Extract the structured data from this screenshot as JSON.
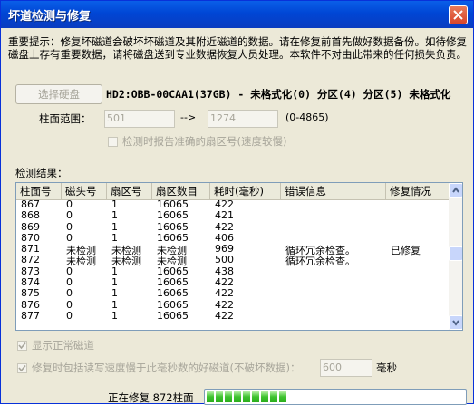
{
  "window": {
    "title": "坏道检测与修复"
  },
  "notice": "重要提示：修复坏磁道会破坏坏磁道及其附近磁道的数据。请在修复前首先做好数据备份。如待修复磁盘上存有重要数据，请将磁盘送到专业数据恢复人员处理。本软件不对由此带来的任何损失负责。",
  "disk": {
    "select_label": "选择硬盘",
    "info": "HD2:OBB-00CAA1(37GB) - 未格式化(0) 分区(4) 分区(5) 未格式化"
  },
  "cylinder": {
    "label": "柱面范围：",
    "from": "501",
    "arrow": "-->",
    "to": "1274",
    "range_hint": "(0-4865)"
  },
  "options": {
    "accurate_sector": "检测时报告准确的扇区号(速度较慢)",
    "show_normal": "显示正常磁道",
    "repair_slow": "修复时包括读写速度慢于此毫秒数的好磁道(不破坏数据)：",
    "ms_value": "600",
    "ms_unit": "毫秒"
  },
  "results": {
    "label": "检测结果：",
    "columns": [
      "柱面号",
      "磁头号",
      "扇区号",
      "扇区数目",
      "耗时(毫秒)",
      "错误信息",
      "修复情况"
    ],
    "rows": [
      [
        "867",
        "0",
        "1",
        "16065",
        "422",
        "",
        ""
      ],
      [
        "868",
        "0",
        "1",
        "16065",
        "421",
        "",
        ""
      ],
      [
        "869",
        "0",
        "1",
        "16065",
        "422",
        "",
        ""
      ],
      [
        "870",
        "0",
        "1",
        "16065",
        "406",
        "",
        ""
      ],
      [
        "871",
        "未检测",
        "未检测",
        "未检测",
        "969",
        "循环冗余检查。",
        "已修复"
      ],
      [
        "872",
        "未检测",
        "未检测",
        "未检测",
        "500",
        "循环冗余检查。",
        ""
      ],
      [
        "873",
        "0",
        "1",
        "16065",
        "438",
        "",
        ""
      ],
      [
        "874",
        "0",
        "1",
        "16065",
        "422",
        "",
        ""
      ],
      [
        "875",
        "0",
        "1",
        "16065",
        "422",
        "",
        ""
      ],
      [
        "876",
        "0",
        "1",
        "16065",
        "422",
        "",
        ""
      ],
      [
        "877",
        "0",
        "1",
        "16065",
        "422",
        "",
        ""
      ]
    ]
  },
  "status": {
    "text": "正在修复 872柱面",
    "progress": 0.32
  },
  "colors": {
    "title_bar": "#0a5fe8",
    "progress": "#3ec22e",
    "window_bg": "#ece9d8"
  }
}
